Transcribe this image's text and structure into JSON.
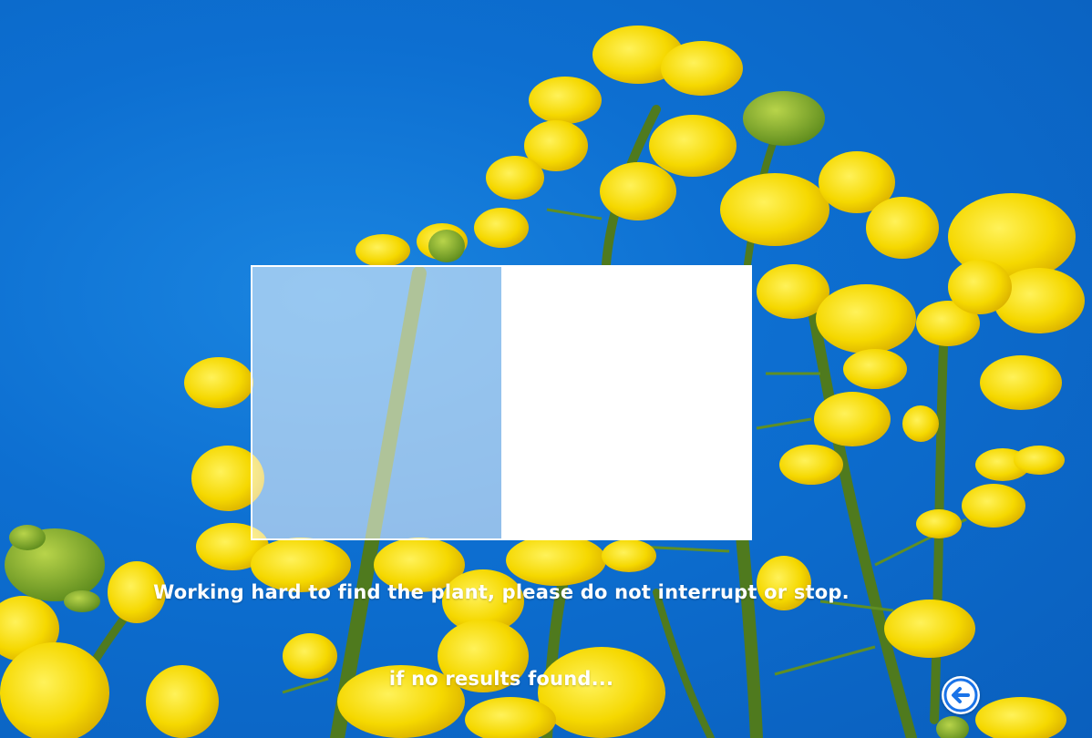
{
  "scan": {
    "progress": 0.5
  },
  "status": {
    "message": "Working hard to find the plant, please do not interrupt or stop.",
    "fallback": "if no results found..."
  },
  "navigation": {
    "back_icon": "arrow-left-icon"
  },
  "colors": {
    "sky": "#0d6fd1",
    "flower": "#f5d800",
    "stem": "#4f7a1e",
    "accent": "#1a73e8"
  }
}
